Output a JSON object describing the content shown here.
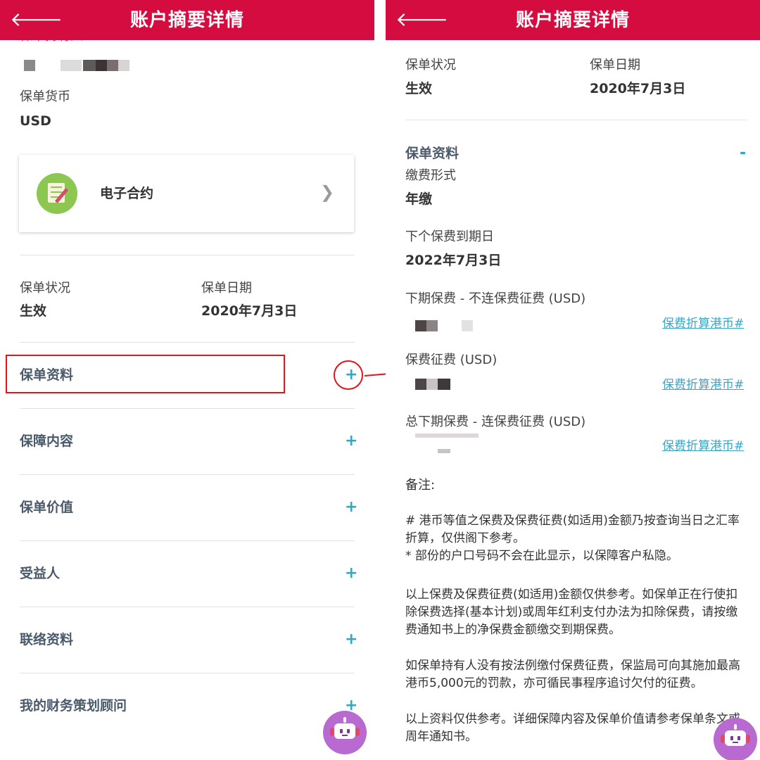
{
  "left": {
    "header_title": "账户摘要详情",
    "back_icon": "arrow-left-icon",
    "policy_holder_label": "保单持有人",
    "currency_label": "保单货币",
    "currency_value": "USD",
    "econtract_label": "电子合约",
    "status_label": "保单状况",
    "status_value": "生效",
    "date_label": "保单日期",
    "date_value": "2020年7月3日",
    "sections": [
      {
        "label": "保单资料",
        "toggle": "+"
      },
      {
        "label": "保障内容",
        "toggle": "+"
      },
      {
        "label": "保单价值",
        "toggle": "+"
      },
      {
        "label": "受益人",
        "toggle": "+"
      },
      {
        "label": "联络资料",
        "toggle": "+"
      },
      {
        "label": "我的财务策划顾问",
        "toggle": "+"
      }
    ]
  },
  "right": {
    "header_title": "账户摘要详情",
    "back_icon": "arrow-left-icon",
    "status_label": "保单状况",
    "status_value": "生效",
    "date_label": "保单日期",
    "date_value": "2020年7月3日",
    "section_title": "保单资料",
    "section_toggle": "-",
    "payment_mode_label": "缴费形式",
    "payment_mode_value": "年缴",
    "next_due_label": "下个保费到期日",
    "next_due_value": "2022年7月3日",
    "premium_excl_label": "下期保费 - 不连保费征费 (USD)",
    "levy_label": "保费征费 (USD)",
    "premium_incl_label": "总下期保费 - 连保费征费 (USD)",
    "hkd_link": "保费折算港币#",
    "remarks_label": "备注:",
    "note1": "# 港币等值之保费及保费征费(如适用)金额乃按查询当日之汇率折算，仅供阁下参考。",
    "note2": "* 部份的户口号码不会在此显示，以保障客户私隐。",
    "para1": "以上保费及保费征费(如适用)金额仅供参考。如保单正在行使扣除保费选择(基本计划)或周年红利支付办法为扣除保费，请按缴费通知书上的净保费金额缴交到期保费。",
    "para2": "如保单持有人没有按法例缴付保费征费，保监局可向其施加最高港币5,000元的罚款，亦可循民事程序追讨欠付的征费。",
    "para3": "以上资料仅供参考。详细保障内容及保单价值请参考保单条文或周年通知书。"
  },
  "colors": {
    "header": "#d50c3f",
    "accent": "#2fa8c8",
    "annotation": "#e2141c"
  }
}
